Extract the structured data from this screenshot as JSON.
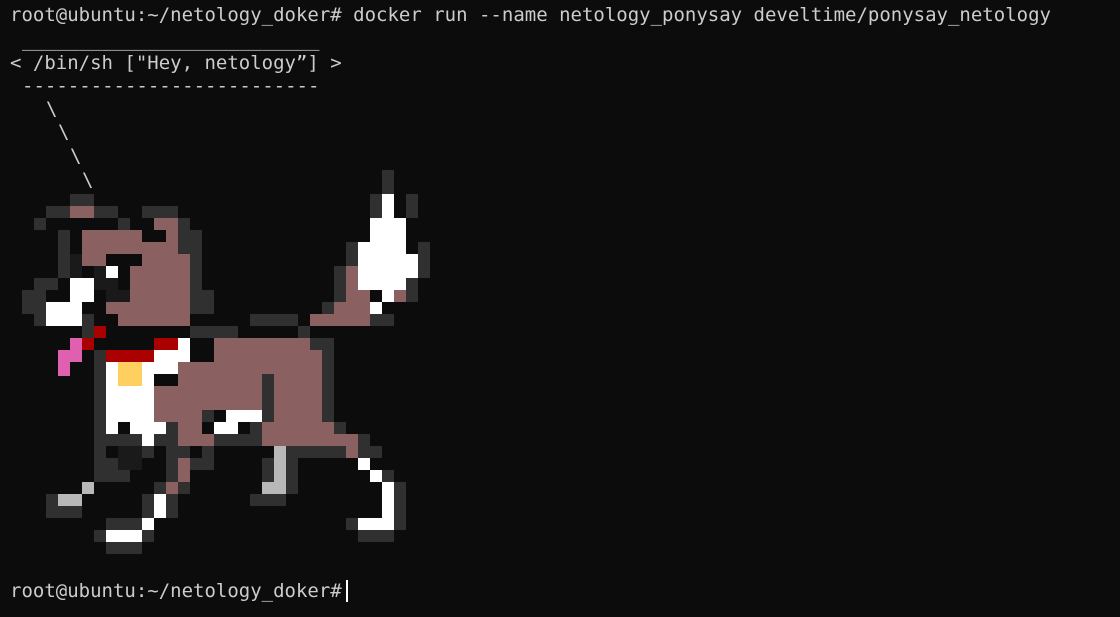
{
  "terminal": {
    "command_line": "root@ubuntu:~/netology_doker# docker run --name netology_ponysay develtime/ponysay_netology",
    "speech_bubble": {
      "top_border": "__________________________",
      "text": "< /bin/sh [\"Hey, netology”] >",
      "bottom_border": "--------------------------"
    },
    "tail": [
      "\\",
      "\\",
      "\\",
      "\\"
    ],
    "prompt": "root@ubuntu:~/netology_doker#"
  },
  "colors": {
    "background": "#0c0c0c",
    "foreground": "#cccccc",
    "pony_body": "#8a6060",
    "pony_outline": "#303030",
    "pony_dark": "#1a1a1a",
    "white": "#ffffff",
    "gray": "#b8b8b8",
    "collar_red": "#aa0000",
    "tongue_pink": "#e060b0",
    "bell_yellow": "#ffcf60"
  },
  "art": {
    "icon": "ponysay-pony-ascii-art"
  }
}
